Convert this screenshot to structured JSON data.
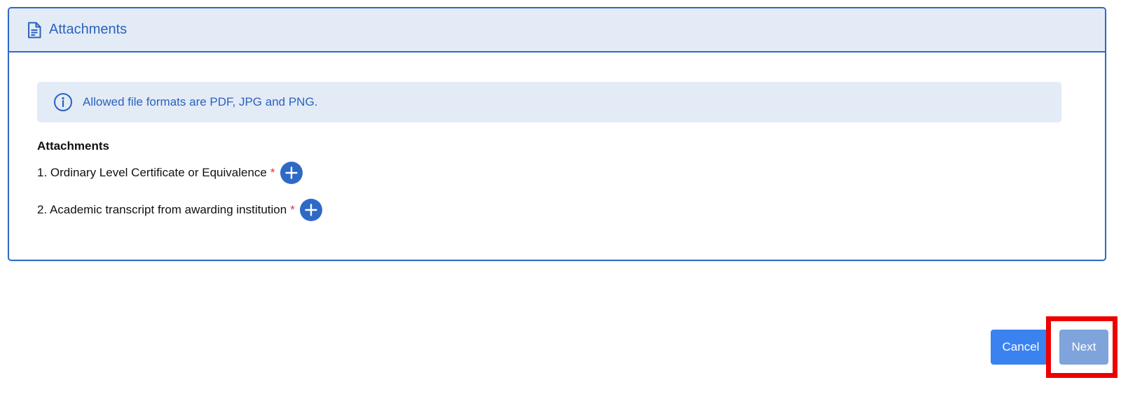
{
  "colors": {
    "primary": "#2f69c6",
    "header_bg": "#e2ebf6",
    "required_star": "#e0353b",
    "cancel_bg": "#3a82f0",
    "next_bg_disabled": "#7fa4dc",
    "highlight": "#ee0000"
  },
  "panel": {
    "header_icon": "document-icon",
    "title": "Attachments"
  },
  "alert": {
    "icon": "info-icon",
    "text": "Allowed file formats are PDF, JPG and PNG."
  },
  "attachments": {
    "heading": "Attachments",
    "items": [
      {
        "label": "1. Ordinary Level Certificate or Equivalence",
        "required_mark": "*",
        "add_icon": "plus-icon"
      },
      {
        "label": "2. Academic transcript from awarding institution",
        "required_mark": "*",
        "add_icon": "plus-icon"
      }
    ]
  },
  "actions": {
    "cancel_label": "Cancel",
    "next_label": "Next",
    "next_state": "disabled"
  }
}
